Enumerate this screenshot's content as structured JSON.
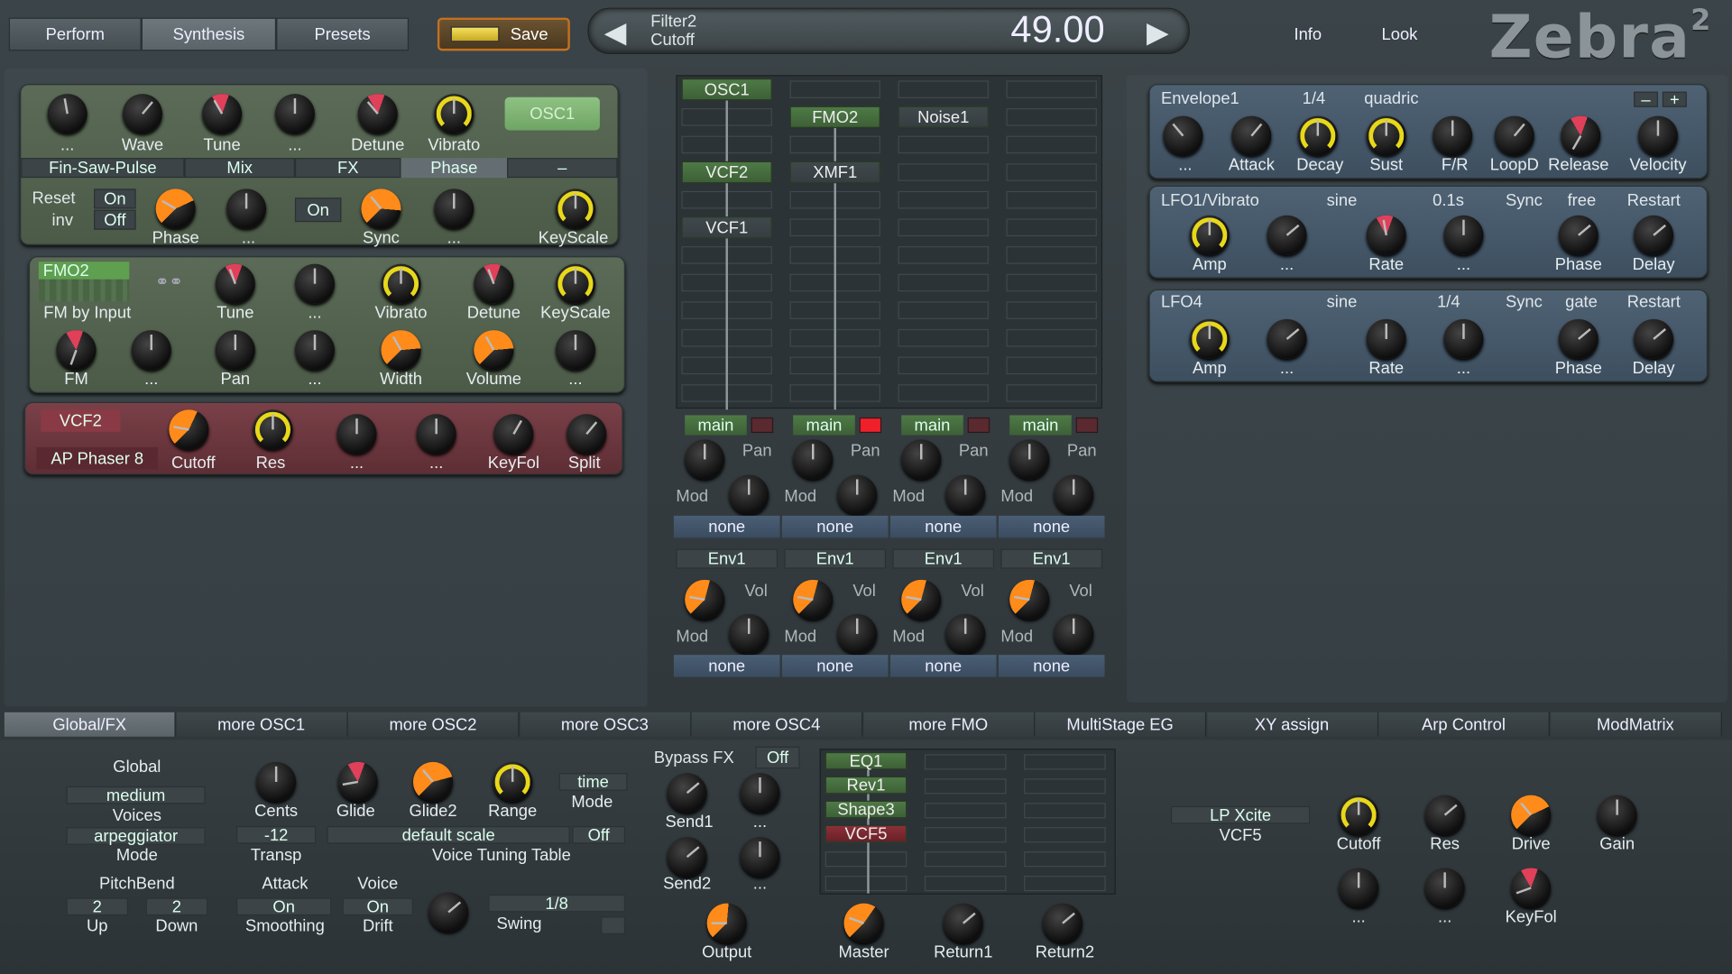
{
  "top": {
    "tabs": [
      "Perform",
      "Synthesis",
      "Presets"
    ],
    "save_label": "Save",
    "param_name": "Filter2",
    "param_sub": "Cutoff",
    "param_value": "49.00",
    "info": "Info",
    "look": "Look",
    "logo": "Zebra",
    "logo_sup": "2"
  },
  "osc1": {
    "k1": "...",
    "k2": "Wave",
    "k3": "Tune",
    "k4": "...",
    "k5": "Detune",
    "k6": "Vibrato",
    "name": "OSC1",
    "tabs": [
      "Fin-Saw-Pulse",
      "Mix",
      "FX",
      "Phase",
      "–"
    ],
    "reset": "Reset",
    "on1": "On",
    "inv": "inv",
    "off": "Off",
    "on2": "On",
    "b1": "Phase",
    "b2": "...",
    "b3": "Sync",
    "b4": "...",
    "b5": "KeyScale"
  },
  "fmo2": {
    "name": "FMO2",
    "mode": "FM by Input",
    "k1": "Tune",
    "k2": "...",
    "k3": "Vibrato",
    "k4": "Detune",
    "k5": "KeyScale",
    "b1": "FM",
    "b2": "...",
    "b3": "Pan",
    "b4": "...",
    "b5": "Width",
    "b6": "Volume",
    "b7": "..."
  },
  "vcf2": {
    "name": "VCF2",
    "type": "AP Phaser 8",
    "k1": "Cutoff",
    "k2": "Res",
    "k3": "...",
    "k4": "...",
    "k5": "KeyFol",
    "k6": "Split"
  },
  "grid": {
    "slots": [
      "OSC1",
      "FMO2",
      "Noise1",
      "VCF2",
      "XMF1",
      "VCF1"
    ],
    "lanes": [
      {
        "out": "main",
        "pan": "Pan",
        "mod": "Mod",
        "src": "none",
        "env": "Env1",
        "vol": "Vol",
        "mod2": "Mod",
        "src2": "none"
      },
      {
        "out": "main",
        "pan": "Pan",
        "mod": "Mod",
        "src": "none",
        "env": "Env1",
        "vol": "Vol",
        "mod2": "Mod",
        "src2": "none"
      },
      {
        "out": "main",
        "pan": "Pan",
        "mod": "Mod",
        "src": "none",
        "env": "Env1",
        "vol": "Vol",
        "mod2": "Mod",
        "src2": "none"
      },
      {
        "out": "main",
        "pan": "Pan",
        "mod": "Mod",
        "src": "none",
        "env": "Env1",
        "vol": "Vol",
        "mod2": "Mod",
        "src2": "none"
      }
    ]
  },
  "env1": {
    "name": "Envelope1",
    "time": "1/4",
    "shape": "quadric",
    "minus": "–",
    "plus": "+",
    "labels": [
      "...",
      "Attack",
      "Decay",
      "Sust",
      "F/R",
      "LoopD",
      "Release",
      "Velocity"
    ]
  },
  "lfo1": {
    "name": "LFO1/Vibrato",
    "wave": "sine",
    "rate": "0.1s",
    "sync": "Sync",
    "mode": "free",
    "restart": "Restart",
    "labels": [
      "Amp",
      "...",
      "Rate",
      "...",
      "Phase",
      "Delay"
    ]
  },
  "lfo4": {
    "name": "LFO4",
    "wave": "sine",
    "rate": "1/4",
    "sync": "Sync",
    "mode": "gate",
    "restart": "Restart",
    "labels": [
      "Amp",
      "...",
      "Rate",
      "...",
      "Phase",
      "Delay"
    ]
  },
  "btabs": [
    "Global/FX",
    "more OSC1",
    "more OSC2",
    "more OSC3",
    "more OSC4",
    "more FMO",
    "MultiStage EG",
    "XY assign",
    "Arp Control",
    "ModMatrix"
  ],
  "global": {
    "title": "Global",
    "voices_val": "medium",
    "voices": "Voices",
    "mode_val": "arpeggiator",
    "mode": "Mode",
    "cents": "Cents",
    "glide": "Glide",
    "glide2": "Glide2",
    "range": "Range",
    "time": "time",
    "timemode": "Mode",
    "transp_val": "-12",
    "transp": "Transp",
    "scale": "default scale",
    "tune_off": "Off",
    "vtt": "Voice Tuning Table",
    "pitchbend": "PitchBend",
    "up_val": "2",
    "up": "Up",
    "down_val": "2",
    "down": "Down",
    "attack": "Attack",
    "smooth_val": "On",
    "smoothing": "Smoothing",
    "voice": "Voice",
    "drift_val": "On",
    "drift": "Drift",
    "swing_val": "1/8",
    "swing": "Swing"
  },
  "fx": {
    "bypass": "Bypass FX",
    "bypass_val": "Off",
    "send1": "Send1",
    "d1": "...",
    "send2": "Send2",
    "d2": "...",
    "output": "Output",
    "master": "Master",
    "return1": "Return1",
    "return2": "Return2",
    "slots": [
      "EQ1",
      "Rev1",
      "Shape3",
      "VCF5"
    ]
  },
  "vcf5": {
    "type": "LP Xcite",
    "name": "VCF5",
    "cutoff": "Cutoff",
    "res": "Res",
    "drive": "Drive",
    "gain": "Gain",
    "d1": "...",
    "d2": "...",
    "keyfol": "KeyFol"
  },
  "colors": {
    "orange": "#ff8b1a",
    "yellow": "#e8d81a",
    "green": "#4e7a46",
    "red_panel": "#7a4048"
  }
}
